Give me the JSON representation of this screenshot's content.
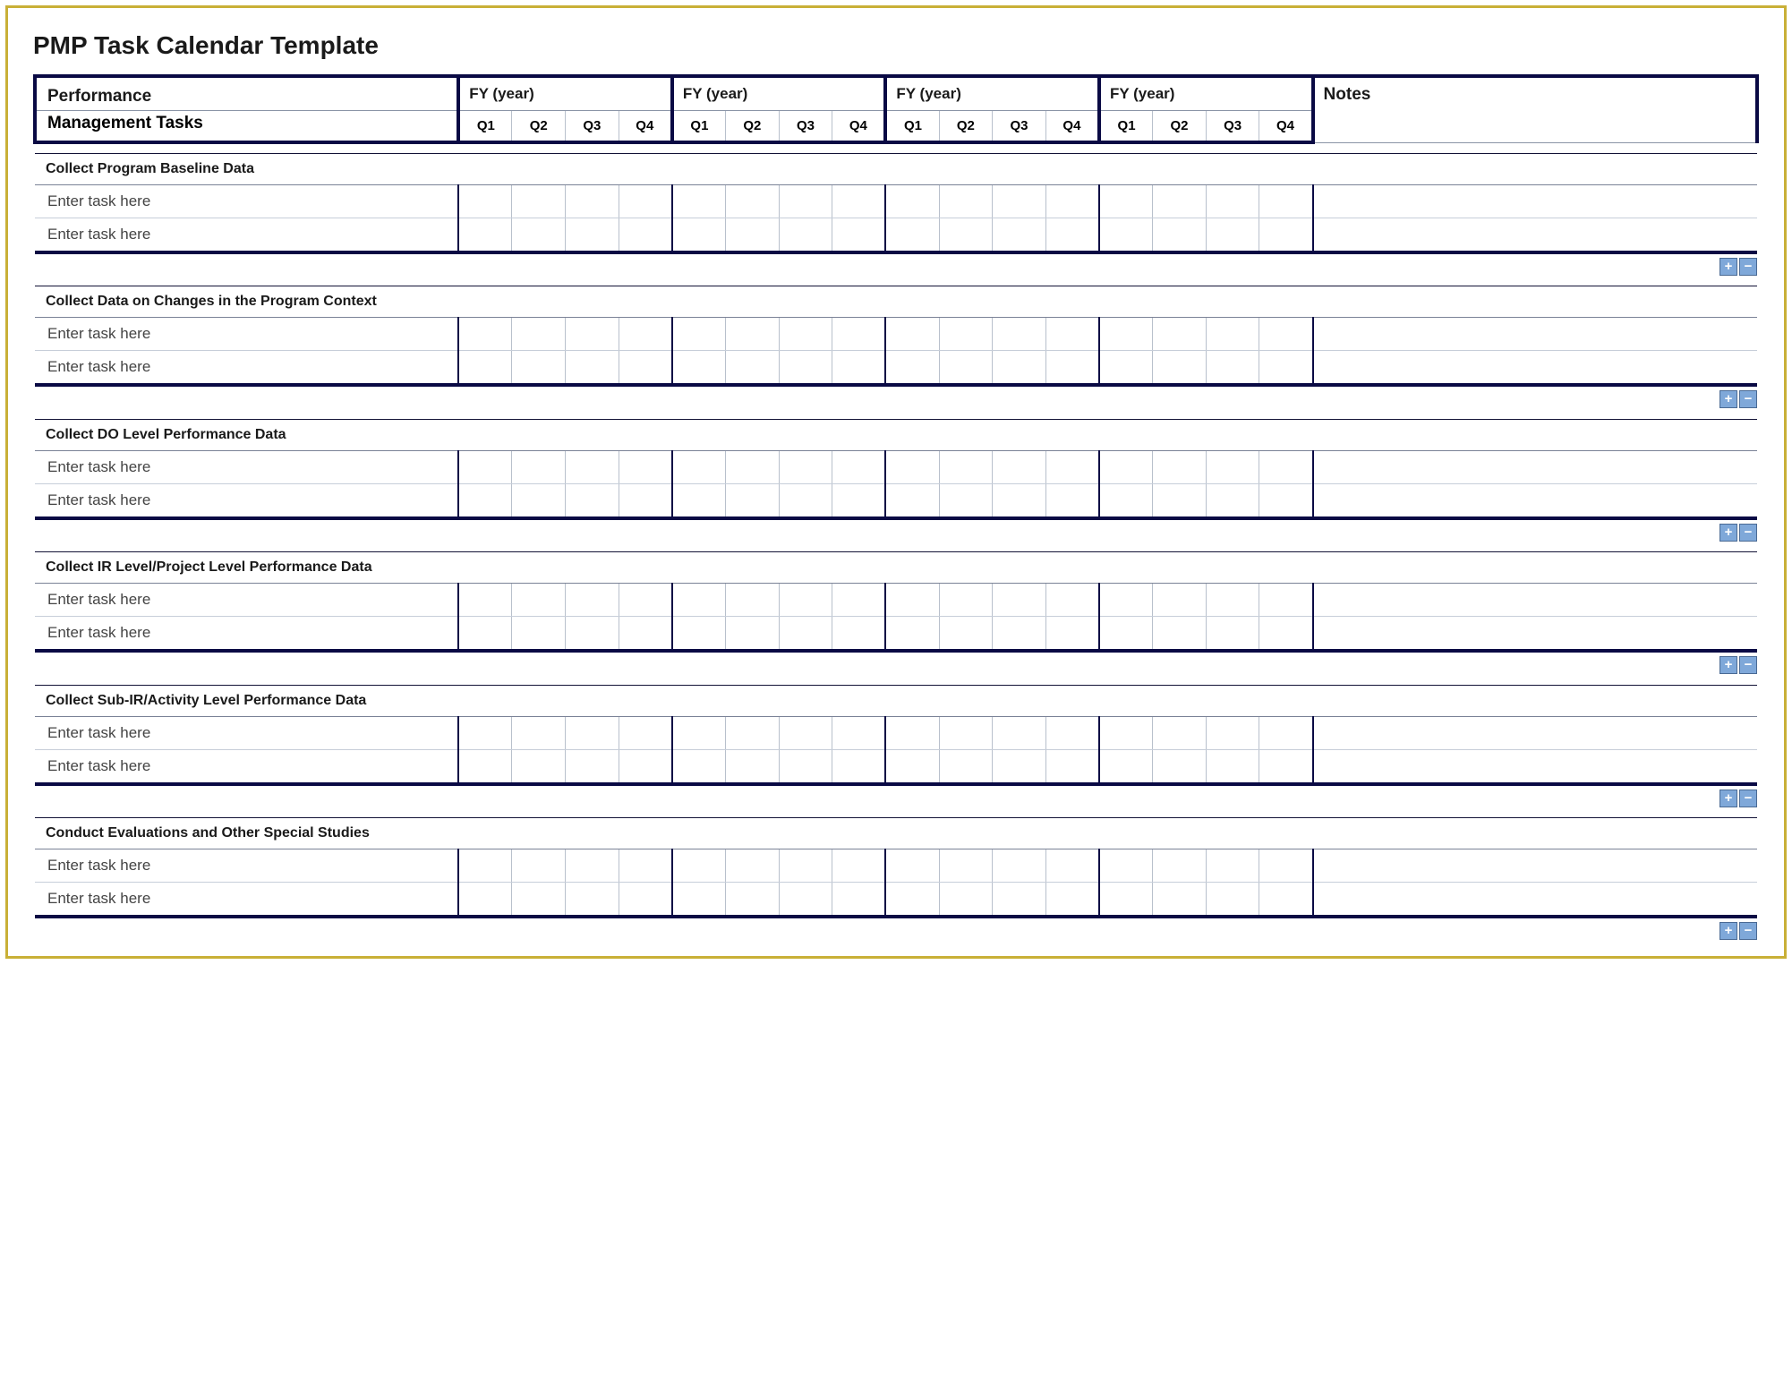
{
  "title": "PMP Task Calendar Template",
  "header": {
    "tasks_label_line1": "Performance",
    "tasks_label_line2": "Management Tasks",
    "fy_label": "FY  (year)",
    "quarters": [
      "Q1",
      "Q2",
      "Q3",
      "Q4"
    ],
    "notes_label": "Notes"
  },
  "sections": [
    {
      "title": "Collect Program Baseline Data",
      "tasks": [
        "Enter task here",
        "Enter task here"
      ]
    },
    {
      "title": "Collect Data on Changes in the Program Context",
      "tasks": [
        "Enter task here",
        "Enter task here"
      ]
    },
    {
      "title": "Collect DO Level Performance Data",
      "tasks": [
        "Enter task here",
        "Enter task here"
      ]
    },
    {
      "title": "Collect IR Level/Project Level Performance Data",
      "tasks": [
        "Enter task here",
        "Enter task here"
      ]
    },
    {
      "title": "Collect Sub-IR/Activity Level Performance Data",
      "tasks": [
        "Enter task here",
        "Enter task here"
      ]
    },
    {
      "title": "Conduct Evaluations and Other Special Studies",
      "tasks": [
        "Enter task here",
        "Enter task here"
      ]
    }
  ],
  "controls": {
    "add": "+",
    "remove": "−"
  }
}
